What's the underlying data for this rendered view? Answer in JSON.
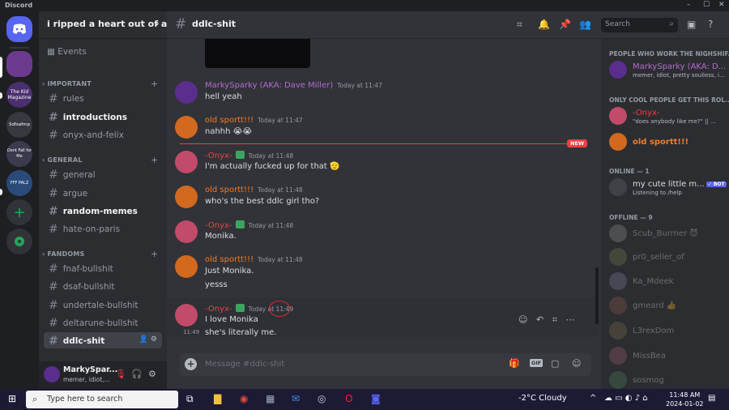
{
  "window": {
    "title": "Discord",
    "controls": [
      "–",
      "☐",
      "✕"
    ]
  },
  "servers": [
    {
      "label": "",
      "color": "#5865f2",
      "icon": "discord-home-icon"
    },
    {
      "label": "",
      "color": "#6c3a8f"
    },
    {
      "label": "The Kid Magazine",
      "color": "#4a2f6e"
    },
    {
      "label": "Sdfsafmp",
      "color": "#36393f"
    },
    {
      "label": "Dont Fall for Me",
      "color": "#3b3b4f"
    },
    {
      "label": "FFF PALZ",
      "color": "#2a4a7a"
    },
    {
      "label": "+",
      "color": "#313338",
      "icon": "add-server-icon"
    },
    {
      "label": "",
      "color": "#313338",
      "icon": "explore-icon"
    }
  ],
  "guild": {
    "name": "i ripped a heart out of a hu"
  },
  "sidebar": {
    "events_label": "Events",
    "categories": [
      {
        "name": "IMPORTANT",
        "channels": [
          {
            "name": "rules",
            "bold": false
          },
          {
            "name": "introductions",
            "bold": true
          },
          {
            "name": "onyx-and-felix",
            "bold": false
          }
        ]
      },
      {
        "name": "GENERAL",
        "channels": [
          {
            "name": "general",
            "bold": false
          },
          {
            "name": "argue",
            "bold": false
          },
          {
            "name": "random-memes",
            "bold": true
          },
          {
            "name": "hate-on-paris",
            "bold": false
          }
        ]
      },
      {
        "name": "FANDOMS",
        "channels": [
          {
            "name": "fnaf-bullshit",
            "bold": false
          },
          {
            "name": "dsaf-bullshit",
            "bold": false
          },
          {
            "name": "undertale-bullshit",
            "bold": false
          },
          {
            "name": "deltarune-bullshit",
            "bold": false
          },
          {
            "name": "ddlc-shit",
            "bold": true,
            "selected": true
          }
        ]
      }
    ]
  },
  "user": {
    "name": "MarkySpar...",
    "status": "memer, idiot,..."
  },
  "header": {
    "channel": "ddlc-shit",
    "search_placeholder": "Search"
  },
  "messages": [
    {
      "author": "MarkySparky (AKA: Dave Miller)",
      "color": "#b46ad4",
      "time": "Today at 11:47",
      "lines": [
        "hell yeah"
      ],
      "avatar": "#5b2d8c"
    },
    {
      "author": "old sportt!!!",
      "color": "#f47b2a",
      "time": "Today at 11:47",
      "lines": [
        "nahhh 😭😭"
      ],
      "avatar": "#d2691e"
    },
    {
      "author": "-Onyx-",
      "color": "#ed4245",
      "time": "Today at 11:48",
      "lines": [
        "I'm actually fucked up for that 🫡"
      ],
      "avatar": "#c24a6a",
      "badge": true
    },
    {
      "author": "old sportt!!!",
      "color": "#f47b2a",
      "time": "Today at 11:48",
      "lines": [
        "who's the best ddlc girl tho?"
      ],
      "avatar": "#d2691e"
    },
    {
      "author": "-Onyx-",
      "color": "#ed4245",
      "time": "Today at 11:48",
      "lines": [
        "Monika."
      ],
      "avatar": "#c24a6a",
      "badge": true
    },
    {
      "author": "old sportt!!!",
      "color": "#f47b2a",
      "time": "Today at 11:48",
      "lines": [
        "Just Monika.",
        "yesss"
      ],
      "avatar": "#d2691e"
    },
    {
      "author": "-Onyx-",
      "color": "#ed4245",
      "time": "Today at 11:49",
      "lines": [
        "I love Monika"
      ],
      "avatar": "#c24a6a",
      "badge": true
    }
  ],
  "continuation": {
    "time": "11:49",
    "text": "she's literally me."
  },
  "new_label": "NEW",
  "composer": {
    "placeholder": "Message #ddlc-shit",
    "gif_label": "GIF"
  },
  "members": {
    "groups": [
      {
        "label": "PEOPLE WHO WORK THE NIGHSHIF...",
        "items": [
          {
            "name": "MarkySparky (AKA: D...",
            "status": "memer, idiot, pretty soulless, i...",
            "color": "#b46ad4",
            "avatar": "#5b2d8c"
          }
        ]
      },
      {
        "label": "ONLY COOL PEOPLE GET THIS ROL...",
        "items": [
          {
            "name": "-Onyx-",
            "status": "\"does anybody like me?\" || ...",
            "color": "#ed4245",
            "avatar": "#c24a6a"
          },
          {
            "name": "old sportt!!!",
            "status": "",
            "color": "#f47b2a",
            "avatar": "#d2691e"
          }
        ]
      },
      {
        "label": "ONLINE — 1",
        "items": [
          {
            "name": "my cute little m...",
            "status": "Listening to /help",
            "color": "#dbdee1",
            "avatar": "#3f4147",
            "bot": "✓ BOT"
          }
        ]
      },
      {
        "label": "OFFLINE — 9",
        "items": [
          {
            "name": "Scub_Burrner 😈",
            "status": "",
            "color": "#dbdee1",
            "avatar": "#8b8b8b"
          },
          {
            "name": "pr0_seller_of",
            "status": "",
            "color": "#dbdee1",
            "avatar": "#6b7a4a"
          },
          {
            "name": "Ka_Mdeek",
            "status": "",
            "color": "#dbdee1",
            "avatar": "#7a7a9a"
          },
          {
            "name": "gmeard 👍",
            "status": "",
            "color": "#dbdee1",
            "avatar": "#8a5a4a"
          },
          {
            "name": "L3rexDom",
            "status": "",
            "color": "#dbdee1",
            "avatar": "#7a6a4a"
          },
          {
            "name": "MissBea",
            "status": "",
            "color": "#dbdee1",
            "avatar": "#9a5a6a"
          },
          {
            "name": "sosmog",
            "status": "",
            "color": "#dbdee1",
            "avatar": "#4a7a5a"
          }
        ]
      }
    ]
  },
  "taskbar": {
    "search_placeholder": "Type here to search",
    "weather": "-2°C  Cloudy",
    "time": "11:48 AM",
    "date": "2024-01-02",
    "notif_count": "1"
  }
}
